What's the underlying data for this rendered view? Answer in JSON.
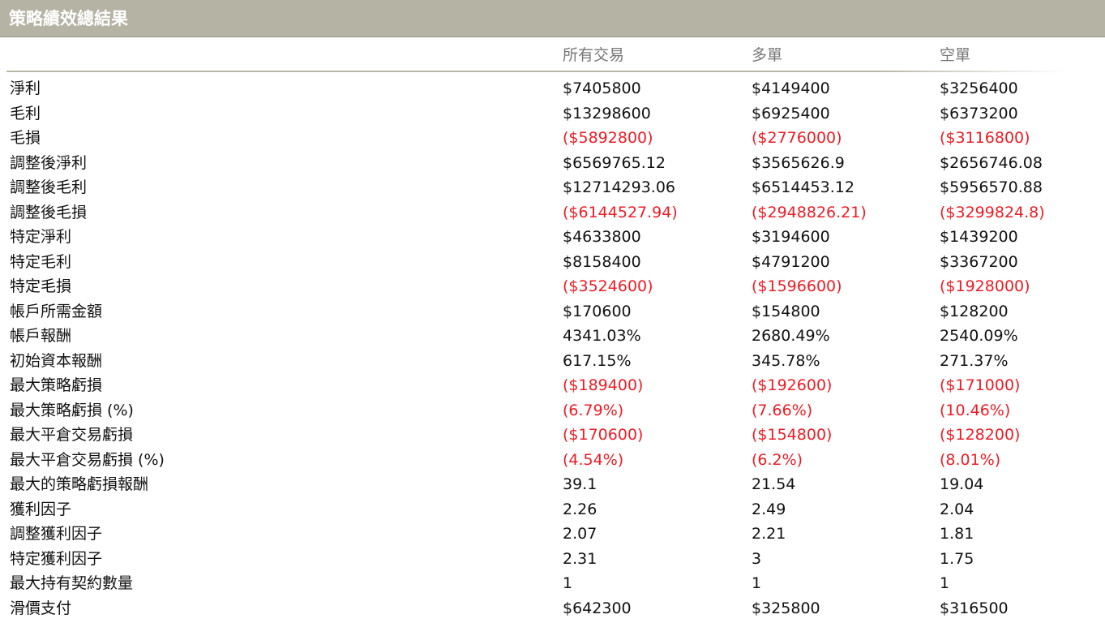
{
  "window": {
    "title": "策略績效總結果"
  },
  "colors": {
    "title_bar": "#b5b3a3",
    "negative": "#ee1c24",
    "header_text": "#777777"
  },
  "columns": [
    "所有交易",
    "多單",
    "空單"
  ],
  "rows": [
    {
      "label": "淨利",
      "all": "$7405800",
      "long": "$4149400",
      "short": "$3256400",
      "negative": false
    },
    {
      "label": "毛利",
      "all": "$13298600",
      "long": "$6925400",
      "short": "$6373200",
      "negative": false
    },
    {
      "label": "毛損",
      "all": "($5892800)",
      "long": "($2776000)",
      "short": "($3116800)",
      "negative": true
    },
    {
      "label": "調整後淨利",
      "all": "$6569765.12",
      "long": "$3565626.9",
      "short": "$2656746.08",
      "negative": false
    },
    {
      "label": "調整後毛利",
      "all": "$12714293.06",
      "long": "$6514453.12",
      "short": "$5956570.88",
      "negative": false
    },
    {
      "label": "調整後毛損",
      "all": "($6144527.94)",
      "long": "($2948826.21)",
      "short": "($3299824.8)",
      "negative": true
    },
    {
      "label": "特定淨利",
      "all": "$4633800",
      "long": "$3194600",
      "short": "$1439200",
      "negative": false
    },
    {
      "label": "特定毛利",
      "all": "$8158400",
      "long": "$4791200",
      "short": "$3367200",
      "negative": false
    },
    {
      "label": "特定毛損",
      "all": "($3524600)",
      "long": "($1596600)",
      "short": "($1928000)",
      "negative": true
    },
    {
      "label": "帳戶所需金額",
      "all": "$170600",
      "long": "$154800",
      "short": "$128200",
      "negative": false
    },
    {
      "label": "帳戶報酬",
      "all": "4341.03%",
      "long": "2680.49%",
      "short": "2540.09%",
      "negative": false
    },
    {
      "label": "初始資本報酬",
      "all": "617.15%",
      "long": "345.78%",
      "short": "271.37%",
      "negative": false
    },
    {
      "label": "最大策略虧損",
      "all": "($189400)",
      "long": "($192600)",
      "short": "($171000)",
      "negative": true
    },
    {
      "label": "最大策略虧損 (%)",
      "all": "(6.79%)",
      "long": "(7.66%)",
      "short": "(10.46%)",
      "negative": true
    },
    {
      "label": "最大平倉交易虧損",
      "all": "($170600)",
      "long": "($154800)",
      "short": "($128200)",
      "negative": true
    },
    {
      "label": "最大平倉交易虧損 (%)",
      "all": "(4.54%)",
      "long": "(6.2%)",
      "short": "(8.01%)",
      "negative": true
    },
    {
      "label": "最大的策略虧損報酬",
      "all": "39.1",
      "long": "21.54",
      "short": "19.04",
      "negative": false
    },
    {
      "label": "獲利因子",
      "all": "2.26",
      "long": "2.49",
      "short": "2.04",
      "negative": false
    },
    {
      "label": "調整獲利因子",
      "all": "2.07",
      "long": "2.21",
      "short": "1.81",
      "negative": false
    },
    {
      "label": "特定獲利因子",
      "all": "2.31",
      "long": "3",
      "short": "1.75",
      "negative": false
    },
    {
      "label": "最大持有契約數量",
      "all": "1",
      "long": "1",
      "short": "1",
      "negative": false
    },
    {
      "label": "滑價支付",
      "all": "$642300",
      "long": "$325800",
      "short": "$316500",
      "negative": false
    }
  ]
}
